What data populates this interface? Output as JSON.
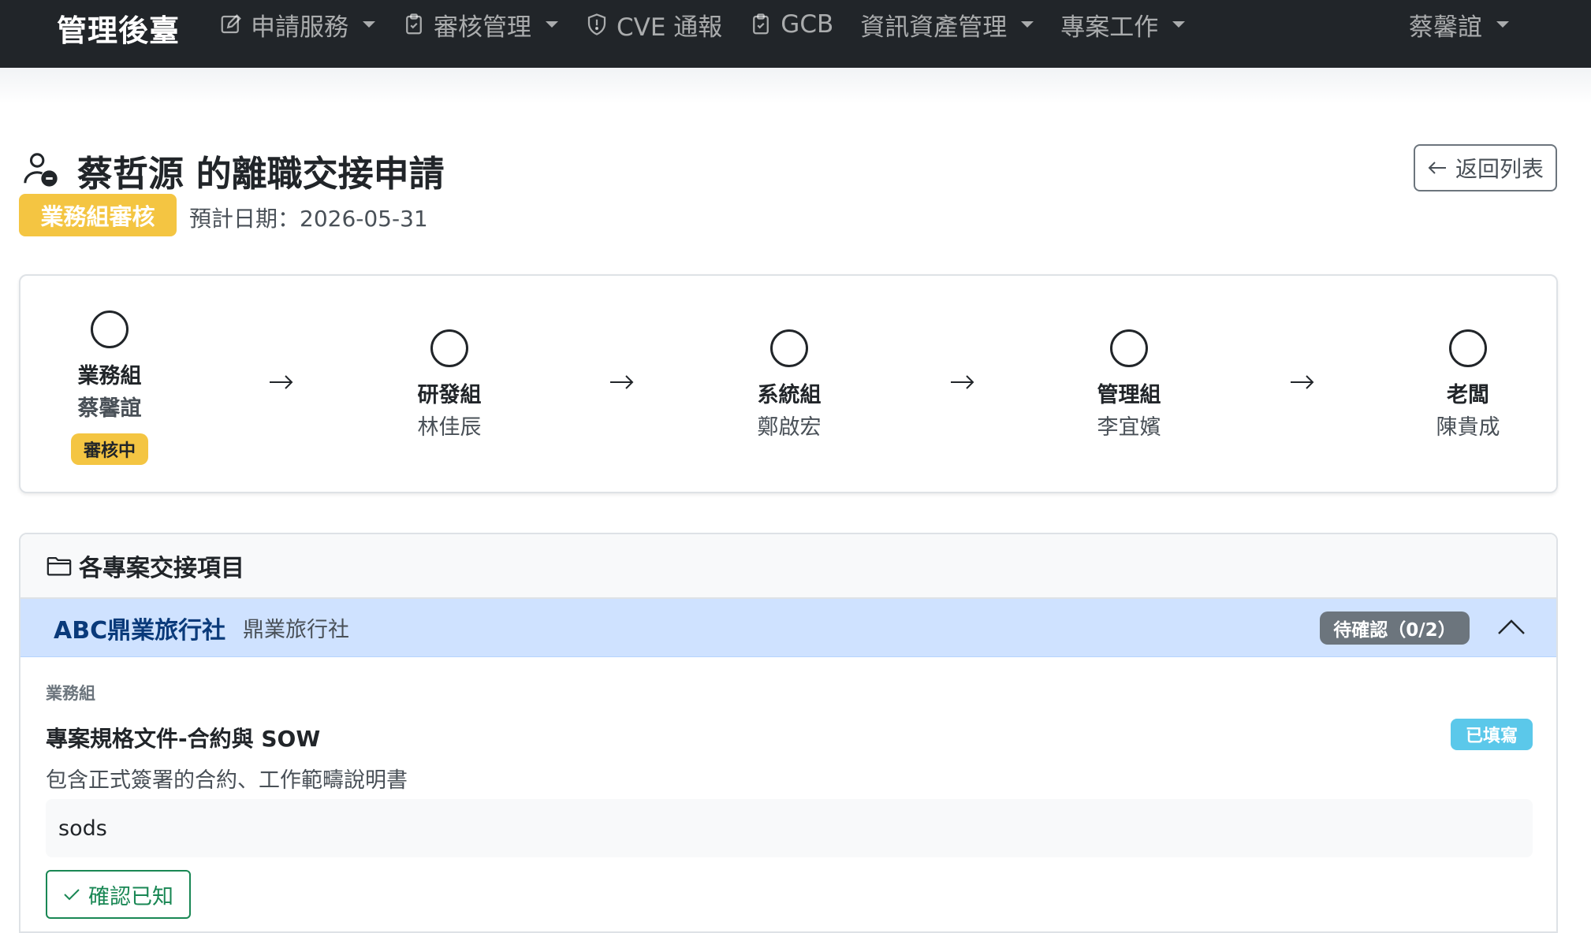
{
  "navbar": {
    "brand": "管理後臺",
    "items": [
      {
        "label": "申請服務",
        "icon": "pencil-square-icon",
        "dropdown": true
      },
      {
        "label": "審核管理",
        "icon": "clipboard-check-icon",
        "dropdown": true
      },
      {
        "label": "CVE 通報",
        "icon": "shield-exclamation-icon",
        "dropdown": false
      },
      {
        "label": "GCB",
        "icon": "clipboard-check-icon",
        "dropdown": false
      },
      {
        "label": "資訊資產管理",
        "icon": null,
        "dropdown": true
      },
      {
        "label": "專案工作",
        "icon": null,
        "dropdown": true
      }
    ],
    "user": "蔡馨誼"
  },
  "header": {
    "title": "蔡哲源 的離職交接申請",
    "status": "業務組審核",
    "due_date": "預計日期：2026-05-31",
    "back_label": "返回列表"
  },
  "workflow": {
    "steps": [
      {
        "dept": "業務組",
        "person": "蔡馨誼",
        "badge": "審核中",
        "active": true
      },
      {
        "dept": "研發組",
        "person": "林佳辰",
        "badge": null,
        "active": false
      },
      {
        "dept": "系統組",
        "person": "鄭啟宏",
        "badge": null,
        "active": false
      },
      {
        "dept": "管理組",
        "person": "李宜嬪",
        "badge": null,
        "active": false
      },
      {
        "dept": "老闆",
        "person": "陳貴成",
        "badge": null,
        "active": false
      }
    ]
  },
  "projects": {
    "title": "各專案交接項目",
    "accordion": {
      "name": "ABC鼎業旅行社",
      "subtitle": "鼎業旅行社",
      "badge": "待確認（0/2）"
    },
    "section_label": "業務組",
    "item": {
      "title": "專案規格文件-合約與 SOW",
      "badge": "已填寫",
      "description": "包含正式簽署的合約、工作範疇說明書",
      "answer": "sods",
      "confirm_label": "確認已知"
    }
  },
  "colors": {
    "navbar_bg": "#212529",
    "warning": "#f4c542",
    "info": "#5bc8ea",
    "success": "#198754",
    "accordion_bg": "#cfe2ff",
    "secondary": "#6c757d"
  }
}
